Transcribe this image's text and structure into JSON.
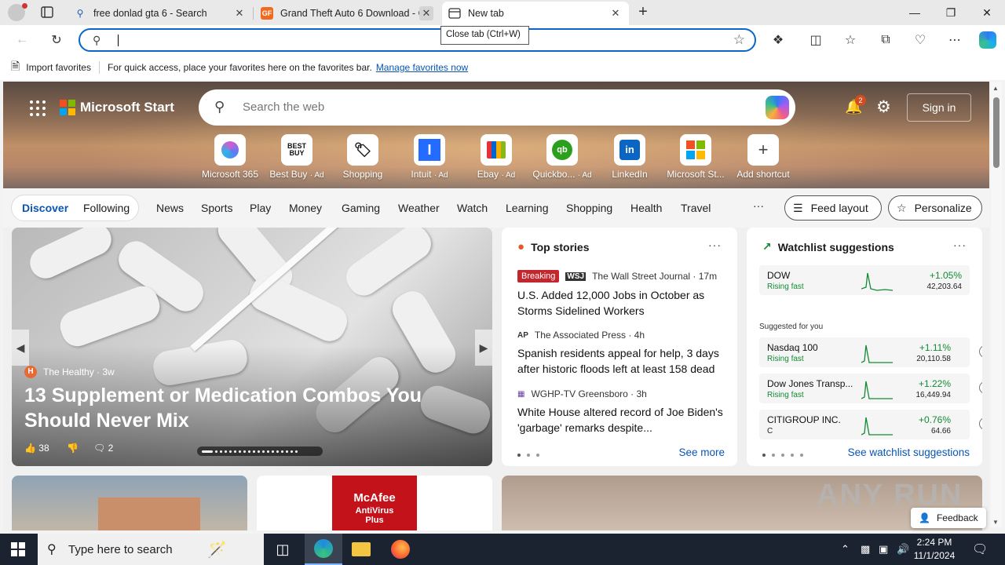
{
  "browser": {
    "tabs": [
      {
        "title": "free donlad gta 6 - Search",
        "icon": "search-icon"
      },
      {
        "title": "Grand Theft Auto 6 Download - G",
        "icon": "gf-icon"
      },
      {
        "title": "New tab",
        "icon": "newtab-icon"
      }
    ],
    "tooltip": "Close tab (Ctrl+W)",
    "address_value": "",
    "favorites_bar": {
      "import_label": "Import favorites",
      "hint": "For quick access, place your favorites here on the favorites bar.",
      "manage_link": "Manage favorites now"
    }
  },
  "page": {
    "brand": "Microsoft Start",
    "search_placeholder": "Search the web",
    "notification_count": "2",
    "signin_label": "Sign in",
    "shortcuts": [
      {
        "label": "Microsoft 365",
        "ad": ""
      },
      {
        "label": "Best Buy",
        "ad": "· Ad"
      },
      {
        "label": "Shopping",
        "ad": ""
      },
      {
        "label": "Intuit",
        "ad": "· Ad"
      },
      {
        "label": "Ebay",
        "ad": "· Ad"
      },
      {
        "label": "Quickbo...",
        "ad": "· Ad"
      },
      {
        "label": "LinkedIn",
        "ad": ""
      },
      {
        "label": "Microsoft St...",
        "ad": ""
      },
      {
        "label": "Add shortcut",
        "ad": ""
      }
    ],
    "feed_tabs": {
      "discover": "Discover",
      "following": "Following"
    },
    "nav": [
      "News",
      "Sports",
      "Play",
      "Money",
      "Gaming",
      "Weather",
      "Watch",
      "Learning",
      "Shopping",
      "Health",
      "Travel"
    ],
    "nav_more": "···",
    "feed_layout_label": "Feed layout",
    "personalize_label": "Personalize",
    "feature": {
      "source": "The Healthy",
      "age": "· 3w",
      "title": "13 Supplement or Medication Combos You Should Never Mix",
      "likes": "38",
      "comments": "2"
    },
    "top_stories": {
      "title": "Top stories",
      "breaking_label": "Breaking",
      "stories": [
        {
          "source": "The Wall Street Journal",
          "age": "· 17m",
          "headline": "U.S. Added 12,000 Jobs in October as Storms Sidelined Workers"
        },
        {
          "source": "The Associated Press",
          "age": "· 4h",
          "headline": "Spanish residents appeal for help, 3 days after historic floods left at least 158 dead"
        },
        {
          "source": "WGHP-TV Greensboro",
          "age": "· 3h",
          "headline": "White House altered record of Joe Biden's 'garbage' remarks despite..."
        }
      ],
      "see_more": "See more"
    },
    "watchlist": {
      "title": "Watchlist suggestions",
      "suggested_label": "Suggested for you",
      "stocks": [
        {
          "name": "DOW",
          "sub": "Rising fast",
          "pct": "+1.05%",
          "value": "42,203.64"
        },
        {
          "name": "Nasdaq 100",
          "sub": "Rising fast",
          "pct": "+1.11%",
          "value": "20,110.58"
        },
        {
          "name": "Dow Jones Transp...",
          "sub": "Rising fast",
          "pct": "+1.22%",
          "value": "16,449.94"
        },
        {
          "name": "CITIGROUP INC.",
          "sub": "C",
          "pct": "+0.76%",
          "value": "64.66"
        }
      ],
      "see_link": "See watchlist suggestions"
    },
    "mcafee": {
      "brand": "McAfee",
      "product": "AntiVirus Plus"
    },
    "feedback_label": "Feedback",
    "watermark": "ANY RUN"
  },
  "taskbar": {
    "search_placeholder": "Type here to search",
    "time": "2:24 PM",
    "date": "11/1/2024"
  }
}
